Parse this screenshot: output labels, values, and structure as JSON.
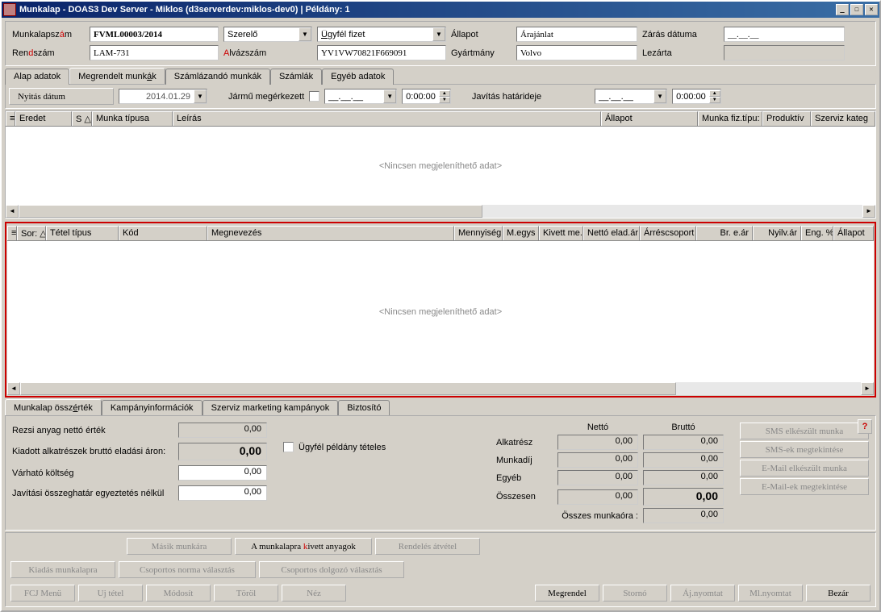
{
  "title": "Munkalap - DOAS3 Dev Server - Miklos (d3serverdev:miklos-dev0) | Példány: 1",
  "form": {
    "munkalapszam_label_pre": "Munkalapsz",
    "munkalapszam_label_mid": "á",
    "munkalapszam_label_post": "m",
    "munkalapszam_value": "FVML00003/2014",
    "szerelo_label": "Szerelő",
    "szerelo_value": "",
    "fizet_label_pre": "Ü",
    "fizet_label_post": "gyfél fizet",
    "allapot_label": "Állapot",
    "allapot_value": "Árajánlat",
    "zaras_label": "Zárás dátuma",
    "zaras_value": "__.__.__",
    "rendszam_label_pre": "Ren",
    "rendszam_label_mid": "d",
    "rendszam_label_post": "szám",
    "rendszam_value": "LAM-731",
    "alvazszam_label_pre": "A",
    "alvazszam_label_post": "lvázszám",
    "alvazszam_value": "YV1VW70821F669091",
    "gyartmany_label": "Gyártmány",
    "gyartmany_value": "Volvo",
    "lezarta_label": "Lezárta",
    "lezarta_value": ""
  },
  "tabs_main": {
    "t1": "Alap adatok",
    "t2_pre": "Megrendelt munk",
    "t2_mid": "á",
    "t2_post": "k",
    "t3": "Számlázandó munkák",
    "t4": "Számlák",
    "t5": "Egyéb adatok"
  },
  "params": {
    "nyitas_label": "Nyitás dátum",
    "nyitas_value": "2014.01.29",
    "jarmu_label": "Jármű megérkezett",
    "date1": "__.__.__",
    "time1": "0:00:00",
    "javitas_label": "Javítás határideje",
    "date2": "__.__.__",
    "time2": "0:00:00"
  },
  "grid1": {
    "cols": {
      "eredet": "Eredet",
      "s": "S",
      "munka_tipusa": "Munka típusa",
      "leiras": "Leírás",
      "allapot": "Állapot",
      "munka_fiz": "Munka fiz.típu:",
      "produktiv": "Produktív",
      "szerviz": "Szerviz kateg"
    },
    "empty": "<Nincsen megjeleníthető adat>"
  },
  "grid2": {
    "cols": {
      "sors": "Sor:",
      "tetel_tipus": "Tétel típus",
      "kod": "Kód",
      "megnevezes": "Megnevezés",
      "mennyiseg": "Mennyiség",
      "megy": "M.egys",
      "kivett": "Kivett me.",
      "netto_elad": "Nettó elad.ár",
      "arres": "Árréscsoport",
      "bre": "Br. e.ár",
      "nyilv": "Nyilv.ár",
      "eng": "Eng. %",
      "allapot": "Állapot"
    },
    "empty": "<Nincsen megjeleníthető adat>"
  },
  "tabs_bottom": {
    "t1_pre": "Munkalap össz",
    "t1_mid": "é",
    "t1_post": "rték",
    "t2": "Kampányinformációk",
    "t3": "Szerviz marketing kampányok",
    "t4": "Biztosító"
  },
  "summary": {
    "rezsi_label": "Rezsi anyag nettó érték",
    "rezsi_value": "0,00",
    "kiadott_label": "Kiadott alkatrészek bruttó eladási áron:",
    "kiadott_value": "0,00",
    "varhato_label": "Várható költség",
    "varhato_value": "0,00",
    "javitasi_label": "Javítási összeghatár egyeztetés nélkül",
    "javitasi_value": "0,00",
    "ugyfel_checkbox": "Ügyfél példány tételes",
    "netto_hdr": "Nettó",
    "brutto_hdr": "Bruttó",
    "alkatresz": "Alkatrész",
    "munkadij": "Munkadíj",
    "egyeb": "Egyéb",
    "osszesen": "Összesen",
    "osszes_munkaora": "Összes munkaóra :",
    "val": "0,00",
    "val_bold": "0,00"
  },
  "email_buttons": {
    "sms_elkeszult": "SMS elkészült munka",
    "sms_megtekint": "SMS-ek megtekintése",
    "email_elkeszult": "E-Mail elkészült munka",
    "email_megtekint": "E-Mail-ek megtekintése"
  },
  "actions": {
    "masik": "Másik munkára",
    "kivett_pre": "A munkalapra ",
    "kivett_mid": "k",
    "kivett_post": "ivett anyagok",
    "rendeles": "Rendelés átvétel",
    "kiadas": "Kiadás munkalapra",
    "csoportos_norma": "Csoportos norma választás",
    "csoportos_dolgozo": "Csoportos dolgozó választás",
    "fcj": "FCJ Menü",
    "uj": "Uj tétel",
    "modosit": "Módosít",
    "torol": "Töröl",
    "nez": "Néz",
    "megrendel": "Megrendel",
    "storno": "Stornó",
    "aj_nyomtat": "Áj.nyomtat",
    "ml_nyomtat": "Ml.nyomtat",
    "bezar": "Bezár"
  }
}
